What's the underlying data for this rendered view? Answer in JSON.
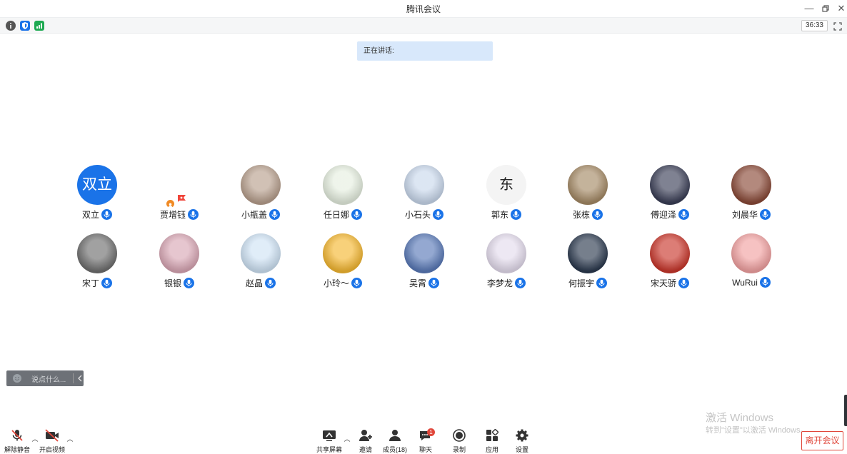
{
  "window": {
    "title": "腾讯会议",
    "timer": "36:33"
  },
  "speaking": {
    "label": "正在讲话:"
  },
  "participants_row1": [
    {
      "name": "双立",
      "avatar_text": "双立",
      "avatar_color": "#1a73e8"
    },
    {
      "name": "贾增钰",
      "avatar_text": "",
      "avatar_color": "#ffffff"
    },
    {
      "name": "小瓶盖",
      "avatar_text": "",
      "avatar_color": "#b8a08e"
    },
    {
      "name": "任日娜",
      "avatar_text": "",
      "avatar_color": "#e6efe0"
    },
    {
      "name": "小石头",
      "avatar_text": "",
      "avatar_color": "#c9d8ec"
    },
    {
      "name": "郭东",
      "avatar_text": "东",
      "avatar_color": "#f4f4f4"
    },
    {
      "name": "张栋",
      "avatar_text": "",
      "avatar_color": "#a58a66"
    },
    {
      "name": "傅迎泽",
      "avatar_text": "",
      "avatar_color": "#3b3f57"
    },
    {
      "name": "刘晨华",
      "avatar_text": "",
      "avatar_color": "#8a4a38"
    }
  ],
  "participants_row2": [
    {
      "name": "宋丁",
      "avatar_text": "",
      "avatar_color": "#6f6f6f"
    },
    {
      "name": "银银",
      "avatar_text": "",
      "avatar_color": "#d9a7b5"
    },
    {
      "name": "赵晶",
      "avatar_text": "",
      "avatar_color": "#cfe3f5"
    },
    {
      "name": "小玲～",
      "avatar_text": "",
      "avatar_color": "#f5b832"
    },
    {
      "name": "吴霄",
      "avatar_text": "",
      "avatar_color": "#5a7ab8"
    },
    {
      "name": "李梦龙",
      "avatar_text": "",
      "avatar_color": "#e4dced"
    },
    {
      "name": "何振宇",
      "avatar_text": "",
      "avatar_color": "#2c3a4f"
    },
    {
      "name": "宋天骄",
      "avatar_text": "",
      "avatar_color": "#c9372c"
    },
    {
      "name": "WuRui",
      "avatar_text": "",
      "avatar_color": "#f2a2a2"
    }
  ],
  "chat": {
    "placeholder": "说点什么..."
  },
  "watermark": {
    "line1": "激活 Windows",
    "line2": "转到\"设置\"以激活 Windows。"
  },
  "toolbar": {
    "unmute": "解除静音",
    "start_video": "开启视频",
    "share_screen": "共享屏幕",
    "invite": "邀请",
    "members": "成员(18)",
    "chat": "聊天",
    "chat_badge": "1",
    "record": "录制",
    "apps": "应用",
    "settings": "设置",
    "leave": "离开会议"
  },
  "colors": {
    "accent": "#1a73e8",
    "leave": "#e0463a",
    "speaking_bg": "#d8e8fb"
  }
}
